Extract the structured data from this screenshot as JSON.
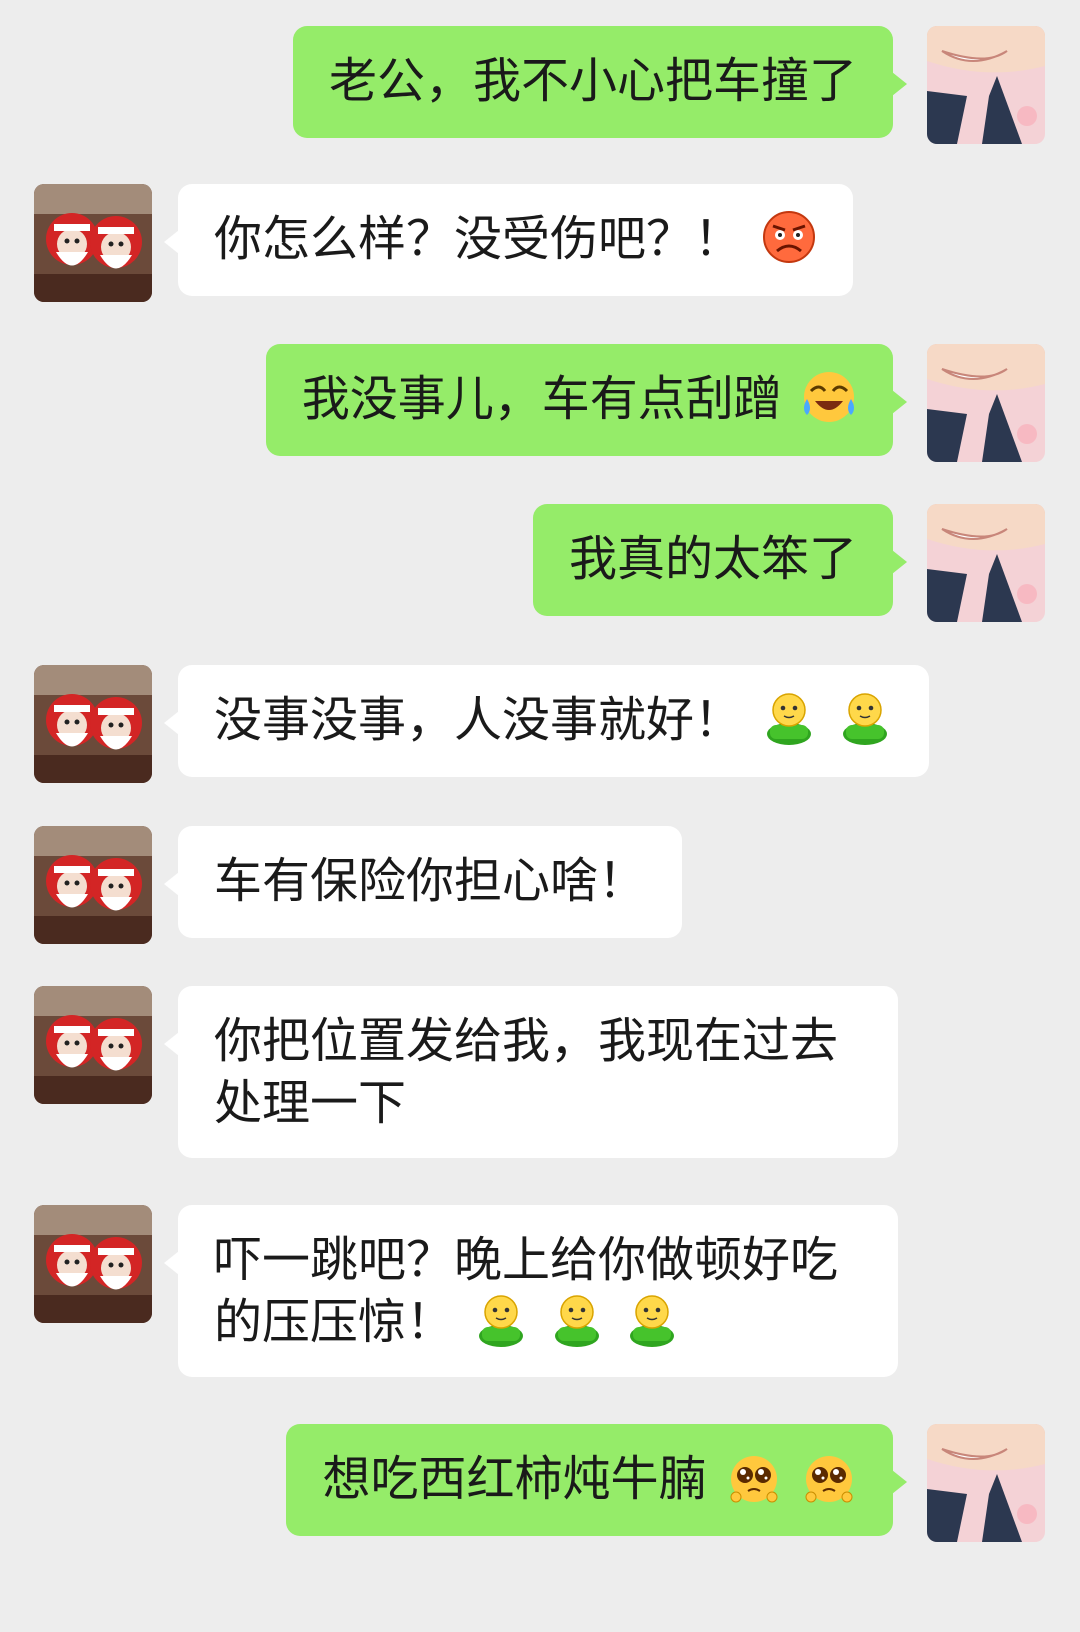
{
  "messages": [
    {
      "side": "out",
      "text": "老公，我不小心把车撞了",
      "emojis": []
    },
    {
      "side": "in",
      "text": "你怎么样？没受伤吧？！",
      "emojis": [
        "angry-face-icon"
      ]
    },
    {
      "side": "out",
      "text": "我没事儿，车有点刮蹭",
      "emojis": [
        "crying-laughing-face-icon"
      ]
    },
    {
      "side": "out",
      "text": "我真的太笨了",
      "emojis": []
    },
    {
      "side": "in",
      "text": "没事没事，人没事就好！",
      "emojis": [
        "green-figure-icon",
        "green-figure-icon"
      ]
    },
    {
      "side": "in",
      "text": "车有保险你担心啥！",
      "emojis": []
    },
    {
      "side": "in",
      "text": "你把位置发给我，我现在过去处理一下",
      "emojis": []
    },
    {
      "side": "in",
      "text": "吓一跳吧？晚上给你做顿好吃的压压惊！",
      "emojis": [
        "green-figure-icon",
        "green-figure-icon",
        "green-figure-icon"
      ]
    },
    {
      "side": "out",
      "text": "想吃西红柿炖牛腩",
      "emojis": [
        "pleading-face-icon",
        "pleading-face-icon"
      ]
    }
  ],
  "colors": {
    "background": "#ededed",
    "incoming_bubble": "#ffffff",
    "outgoing_bubble": "#95ec69"
  },
  "avatars": {
    "incoming": "santa-dolls-avatar",
    "outgoing": "child-photo-avatar"
  }
}
